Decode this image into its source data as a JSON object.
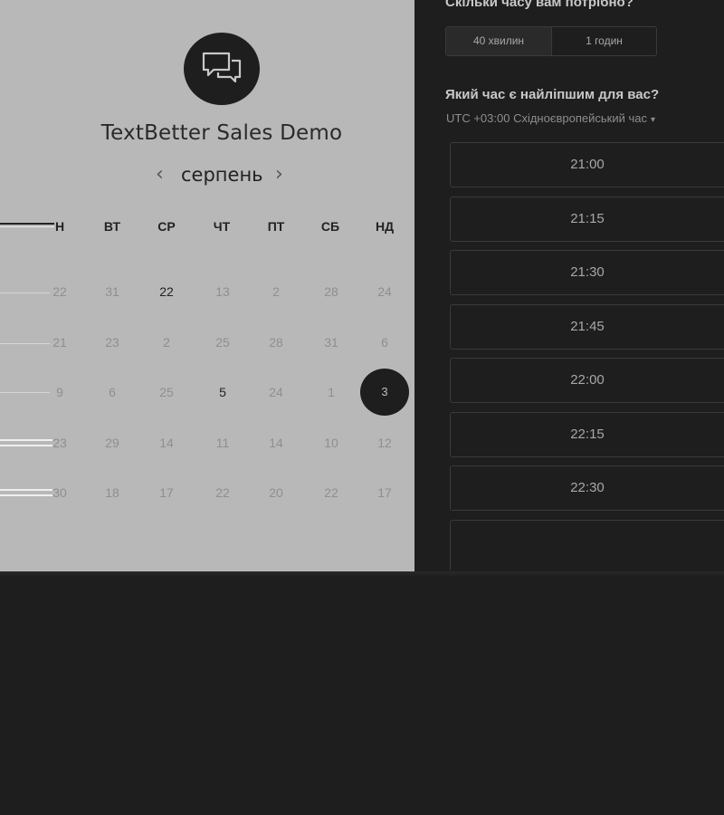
{
  "event": {
    "title": "TextBetter Sales Demo",
    "logo_icon": "chat-bubbles-icon"
  },
  "calendar": {
    "month": "серпень",
    "prev_icon": "‹",
    "next_icon": "›",
    "weekdays": [
      "ПН",
      "ВТ",
      "СР",
      "ЧТ",
      "ПТ",
      "СБ",
      "НД"
    ],
    "weekday_partial": "Н",
    "rows": [
      [
        "22",
        "31",
        "22",
        "13",
        "2",
        "28",
        "24"
      ],
      [
        "21",
        "23",
        "2",
        "25",
        "28",
        "31",
        "6"
      ],
      [
        "9",
        "6",
        "25",
        "5",
        "24",
        "1",
        "3"
      ],
      [
        "23",
        "29",
        "14",
        "11",
        "14",
        "10",
        "12"
      ],
      [
        "30",
        "18",
        "17",
        "22",
        "20",
        "22",
        "17"
      ]
    ],
    "selected_day": "3"
  },
  "booking": {
    "duration_question": "Скільки часу вам потрібно?",
    "durations": [
      "40 хвилин",
      "1 годин"
    ],
    "time_question": "Який час є найліпшим для вас?",
    "timezone": "UTC +03:00 Східноєвропейський час",
    "timezone_caret": "▾",
    "slots": [
      "21:00",
      "21:15",
      "21:30",
      "21:45",
      "22:00",
      "22:15",
      "22:30"
    ]
  }
}
